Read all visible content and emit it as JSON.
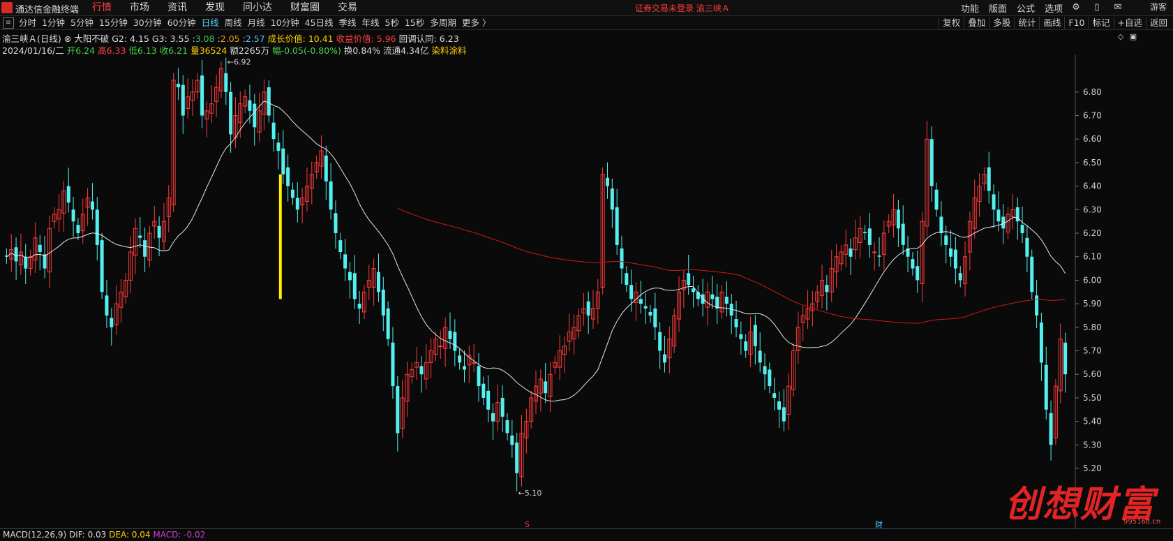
{
  "app": {
    "title": "通达信金融终端"
  },
  "menu": [
    "行情",
    "市场",
    "资讯",
    "发现",
    "问小达",
    "财富圈",
    "交易"
  ],
  "menu_active": "行情",
  "alert": "证券交易未登录  渝三峡Ａ",
  "right_menu": [
    "功能",
    "版面",
    "公式",
    "选项"
  ],
  "user": "游客",
  "periods": [
    "分时",
    "1分钟",
    "5分钟",
    "15分钟",
    "30分钟",
    "60分钟",
    "日线",
    "周线",
    "月线",
    "10分钟",
    "45日线",
    "季线",
    "年线",
    "5秒",
    "15秒",
    "多周期",
    "更多 〉"
  ],
  "period_active": "日线",
  "tools": [
    "复权",
    "叠加",
    "多股",
    "统计",
    "画线",
    "F10",
    "标记",
    "+自选",
    "返回"
  ],
  "info_line1": {
    "name": "渝三峡Ａ(日线)",
    "indicator": "大阳不破",
    "g2": "G2: 4.15",
    "g3": "G3: 3.55",
    "v1": "3.08",
    "v2": "2.05",
    "v3": "2.57",
    "growth": "成长价值: 10.41",
    "earn": "收益价值: 5.96",
    "pullback": "回调认同: 6.23"
  },
  "info_line2": {
    "date": "2024/01/16/二",
    "open": "开6.24",
    "high": "高6.33",
    "low": "低6.13",
    "close": "收6.21",
    "vol": "量36524",
    "amount": "额2265万",
    "change": "幅-0.05(-0.80%)",
    "turnover": "换0.84%",
    "float": "流通4.34亿",
    "sector": "染料涂料"
  },
  "macd": {
    "label": "MACD(12,26,9)",
    "dif": "DIF: 0.03",
    "dea": "DEA: 0.04",
    "macd": "MACD: -0.02"
  },
  "watermark": {
    "text": "创想财富",
    "url": "995168.cn"
  },
  "chart_data": {
    "type": "candlestick",
    "y_ticks": [
      "6.80",
      "6.70",
      "6.60",
      "6.50",
      "6.40",
      "6.30",
      "6.20",
      "6.10",
      "6.00",
      "5.90",
      "5.80",
      "5.70",
      "5.60",
      "5.50",
      "5.40",
      "5.30",
      "5.20"
    ],
    "ylim": [
      5.12,
      6.93
    ],
    "high_label": "6.92",
    "low_label": "5.10",
    "markers": [
      "S",
      "财"
    ],
    "colors": {
      "up": "#ff3b3b",
      "down": "#54f0f0",
      "ma_white": "#e6e6e6",
      "ma_red": "#d01818",
      "highlight": "#ffee00"
    },
    "close_path": [
      6.1,
      6.13,
      6.08,
      6.12,
      6.05,
      6.1,
      6.18,
      6.12,
      6.05,
      6.22,
      6.28,
      6.3,
      6.38,
      6.33,
      6.25,
      6.2,
      6.28,
      6.35,
      6.3,
      6.15,
      5.95,
      5.85,
      5.8,
      5.9,
      5.95,
      6.0,
      6.12,
      6.22,
      6.18,
      6.1,
      6.2,
      6.25,
      6.18,
      6.25,
      6.35,
      6.85,
      6.82,
      6.7,
      6.78,
      6.8,
      6.85,
      6.7,
      6.72,
      6.75,
      6.82,
      6.9,
      6.8,
      6.62,
      6.7,
      6.75,
      6.78,
      6.72,
      6.65,
      6.72,
      6.8,
      6.7,
      6.6,
      6.55,
      6.45,
      6.4,
      6.35,
      6.3,
      6.35,
      6.4,
      6.45,
      6.5,
      6.55,
      6.42,
      6.3,
      6.2,
      6.12,
      6.05,
      6.0,
      5.92,
      5.88,
      5.95,
      6.0,
      6.05,
      5.95,
      5.85,
      5.75,
      5.55,
      5.35,
      5.5,
      5.6,
      5.62,
      5.65,
      5.6,
      5.65,
      5.7,
      5.75,
      5.72,
      5.8,
      5.75,
      5.7,
      5.65,
      5.62,
      5.68,
      5.65,
      5.55,
      5.5,
      5.45,
      5.4,
      5.48,
      5.42,
      5.35,
      5.3,
      5.18,
      5.35,
      5.4,
      5.5,
      5.55,
      5.58,
      5.52,
      5.6,
      5.65,
      5.7,
      5.72,
      5.78,
      5.8,
      5.85,
      5.88,
      5.85,
      5.88,
      5.95,
      6.45,
      6.4,
      6.3,
      6.15,
      6.05,
      5.98,
      5.92,
      5.95,
      5.9,
      5.88,
      5.85,
      5.8,
      5.7,
      5.65,
      5.75,
      5.85,
      5.95,
      6.0,
      5.98,
      5.95,
      5.92,
      5.9,
      5.95,
      5.92,
      5.88,
      5.95,
      5.9,
      5.85,
      5.8,
      5.75,
      5.7,
      5.78,
      5.72,
      5.65,
      5.6,
      5.55,
      5.5,
      5.45,
      5.4,
      5.55,
      5.7,
      5.8,
      5.85,
      5.88,
      5.9,
      5.95,
      6.0,
      5.95,
      6.05,
      6.1,
      6.12,
      6.15,
      6.1,
      6.18,
      6.22,
      6.2,
      6.15,
      6.12,
      6.1,
      6.2,
      6.25,
      6.3,
      6.22,
      6.15,
      6.1,
      6.05,
      6.0,
      6.25,
      6.6,
      6.4,
      6.3,
      6.2,
      6.15,
      6.1,
      6.05,
      6.0,
      6.1,
      6.25,
      6.35,
      6.4,
      6.45,
      6.38,
      6.3,
      6.25,
      6.22,
      6.28,
      6.3,
      6.25,
      6.2,
      6.1,
      5.95,
      5.85,
      5.65,
      5.45,
      5.3,
      5.55,
      5.75,
      5.6
    ]
  }
}
